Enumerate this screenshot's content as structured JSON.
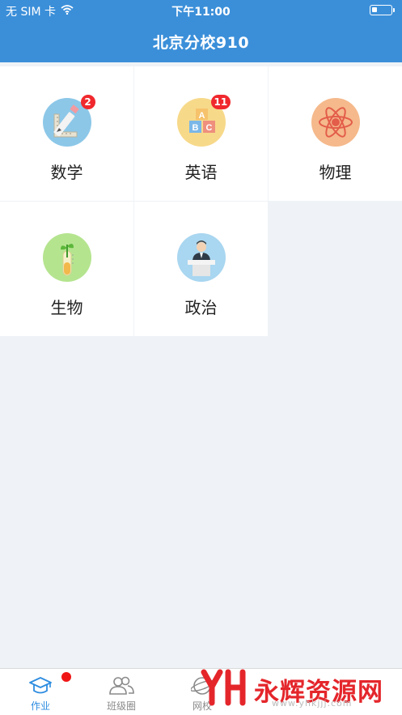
{
  "status_bar": {
    "carrier": "无 SIM 卡",
    "time": "下午11:00"
  },
  "nav": {
    "title": "北京分校910"
  },
  "subjects": [
    {
      "label": "数学",
      "icon": "math-ruler-pencil-icon",
      "badge": "2",
      "circle_color": "#8cc7e8"
    },
    {
      "label": "英语",
      "icon": "abc-blocks-icon",
      "badge": "11",
      "circle_color": "#f7d98a"
    },
    {
      "label": "物理",
      "icon": "atom-icon",
      "badge": "",
      "circle_color": "#f5b98b"
    },
    {
      "label": "生物",
      "icon": "plant-test-tube-icon",
      "badge": "",
      "circle_color": "#b5e48f"
    },
    {
      "label": "政治",
      "icon": "speaker-podium-icon",
      "badge": "",
      "circle_color": "#a9d6f0"
    }
  ],
  "tabbar": {
    "items": [
      {
        "label": "作业",
        "icon": "graduation-cap-icon",
        "active": true,
        "dot": true
      },
      {
        "label": "班级圈",
        "icon": "people-icon",
        "active": false,
        "dot": false
      },
      {
        "label": "网校",
        "icon": "globe-icon",
        "active": false,
        "dot": false
      }
    ]
  },
  "watermark": {
    "logo": "YH",
    "text": "永辉资源网",
    "url": "www.yhkjjj.com"
  },
  "colors": {
    "header_bg": "#3b8fd9",
    "page_bg": "#eff3f7",
    "badge": "#f0282d",
    "tab_active": "#2d8ce0"
  }
}
